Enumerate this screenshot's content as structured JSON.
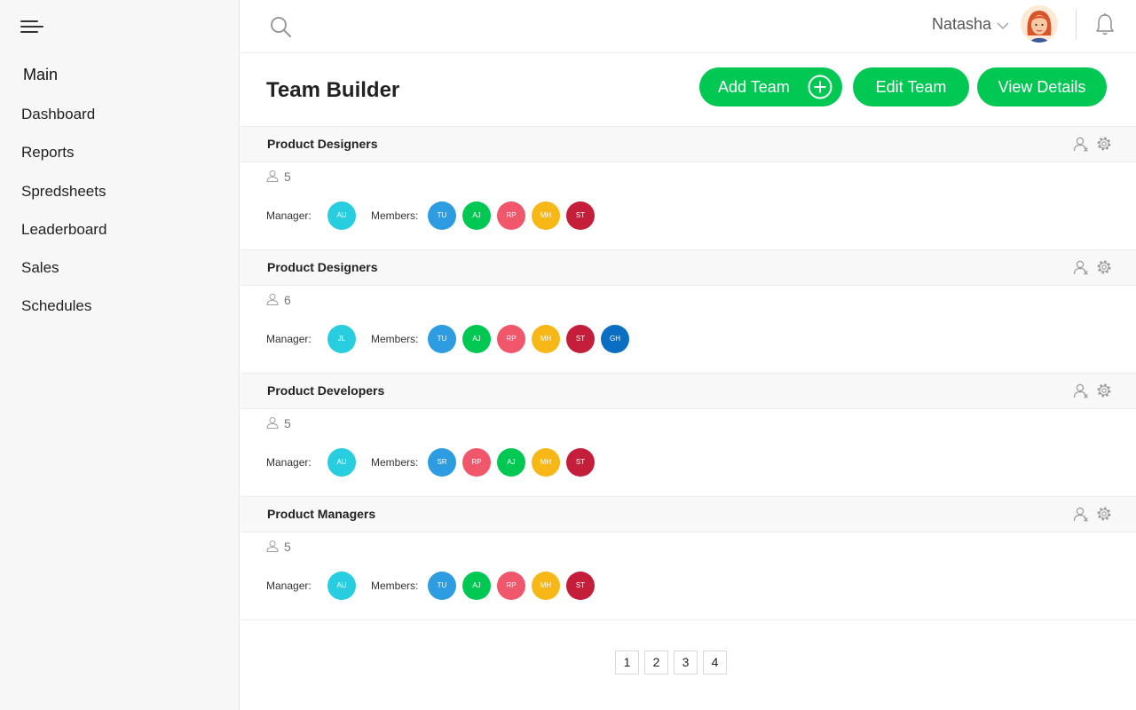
{
  "sidebar": {
    "section": "Main",
    "items": [
      {
        "label": "Dashboard"
      },
      {
        "label": "Reports"
      },
      {
        "label": "Spredsheets"
      },
      {
        "label": "Leaderboard"
      },
      {
        "label": "Sales"
      },
      {
        "label": "Schedules"
      }
    ]
  },
  "header": {
    "user_name": "Natasha"
  },
  "page": {
    "title": "Team Builder",
    "buttons": {
      "add": "Add Team",
      "edit": "Edit Team",
      "view": "View Details"
    }
  },
  "labels": {
    "manager": "Manager:",
    "members": "Members:"
  },
  "colors": {
    "accent": "#00c853",
    "cyan": "#29cde0",
    "blue": "#2d9ce0",
    "green": "#00c853",
    "coral": "#f0576a",
    "amber": "#f6b717",
    "red": "#c41e3a",
    "darkblue": "#0a6fc2"
  },
  "teams": [
    {
      "name": "Product Designers",
      "count": "5",
      "manager": {
        "initials": "AU",
        "color": "#29cde0"
      },
      "members": [
        {
          "initials": "TU",
          "color": "#2d9ce0"
        },
        {
          "initials": "AJ",
          "color": "#00c853"
        },
        {
          "initials": "RP",
          "color": "#f0576a"
        },
        {
          "initials": "MH",
          "color": "#f6b717"
        },
        {
          "initials": "ST",
          "color": "#c41e3a"
        }
      ]
    },
    {
      "name": "Product Designers",
      "count": "6",
      "manager": {
        "initials": "JL",
        "color": "#29cde0"
      },
      "members": [
        {
          "initials": "TU",
          "color": "#2d9ce0"
        },
        {
          "initials": "AJ",
          "color": "#00c853"
        },
        {
          "initials": "RP",
          "color": "#f0576a"
        },
        {
          "initials": "MH",
          "color": "#f6b717"
        },
        {
          "initials": "ST",
          "color": "#c41e3a"
        },
        {
          "initials": "GH",
          "color": "#0a6fc2"
        }
      ]
    },
    {
      "name": "Product Developers",
      "count": "5",
      "manager": {
        "initials": "AU",
        "color": "#29cde0"
      },
      "members": [
        {
          "initials": "SR",
          "color": "#2d9ce0"
        },
        {
          "initials": "RP",
          "color": "#f0576a"
        },
        {
          "initials": "AJ",
          "color": "#00c853"
        },
        {
          "initials": "MH",
          "color": "#f6b717"
        },
        {
          "initials": "ST",
          "color": "#c41e3a"
        }
      ]
    },
    {
      "name": "Product Managers",
      "count": "5",
      "manager": {
        "initials": "AU",
        "color": "#29cde0"
      },
      "members": [
        {
          "initials": "TU",
          "color": "#2d9ce0"
        },
        {
          "initials": "AJ",
          "color": "#00c853"
        },
        {
          "initials": "RP",
          "color": "#f0576a"
        },
        {
          "initials": "MH",
          "color": "#f6b717"
        },
        {
          "initials": "ST",
          "color": "#c41e3a"
        }
      ]
    }
  ],
  "pagination": [
    "1",
    "2",
    "3",
    "4"
  ]
}
